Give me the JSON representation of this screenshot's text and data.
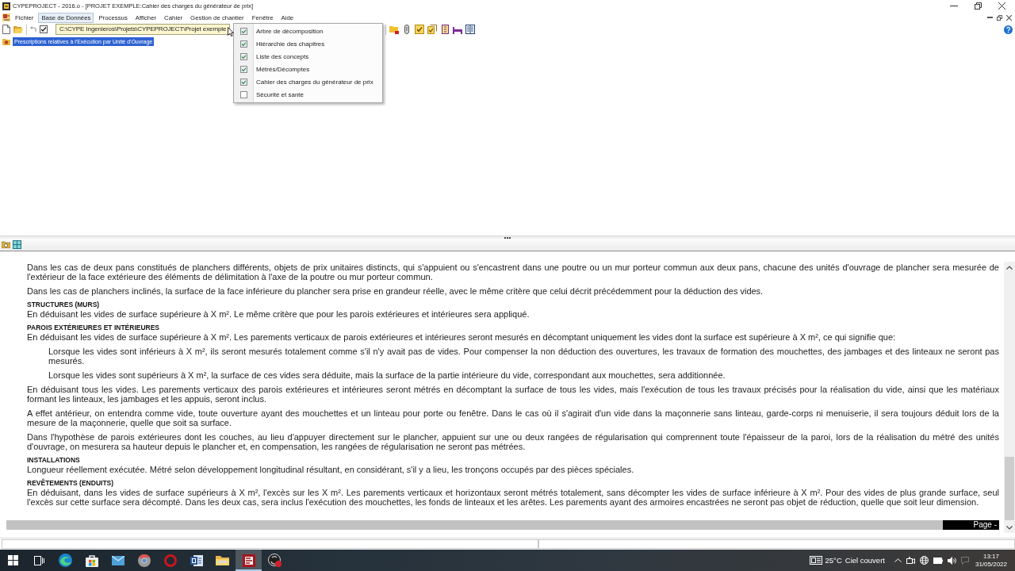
{
  "window": {
    "title": "CYPEPROJECT - 2016.o - [PROJET EXEMPLE:Cahier des charges du générateur de prix]"
  },
  "menu_bar": [
    {
      "label": "Fichier",
      "selected": false
    },
    {
      "label": "Base de Données",
      "selected": true
    },
    {
      "label": "Processus",
      "selected": false
    },
    {
      "label": "Afficher",
      "selected": false
    },
    {
      "label": "Cahier",
      "selected": false
    },
    {
      "label": "Gestion de chantier",
      "selected": false
    },
    {
      "label": "Fenêtre",
      "selected": false
    },
    {
      "label": "Aide",
      "selected": false
    }
  ],
  "toolbar": {
    "toggle": {
      "checked": true
    },
    "tooltip": "C:\\CYPE Ingenieros\\Projets\\CYPEPROJECT\\Projet exemple"
  },
  "dropdown_menu": [
    {
      "label": "Arbre de décomposition",
      "checked": true
    },
    {
      "label": "Hiérarchie des chapitres",
      "checked": true
    },
    {
      "label": "Liste des concepts",
      "checked": true
    },
    {
      "label": "Métrés/Décomptes",
      "checked": true
    },
    {
      "label": "Cahier des charges du générateur de prix",
      "checked": true
    },
    {
      "label": "Sécurité et santé",
      "checked": false
    }
  ],
  "tree": [
    {
      "label": "Prescriptions relatives à l'Exécution par Unité d'Ouvrage",
      "selected": true
    }
  ],
  "document": {
    "blocks": [
      {
        "kind": "paragraph",
        "text": "Dans les cas de deux pans constitués de planchers différents, objets de prix unitaires distincts, qui s'appuient ou s'encastrent dans une poutre ou un mur porteur commun aux deux pans, chacune des unités d'ouvrage de plancher sera mesurée de l'extérieur de la face extérieure des éléments de délimitation à l'axe de la poutre ou mur porteur commun."
      },
      {
        "kind": "paragraph",
        "text": "Dans les cas de planchers inclinés, la surface de la face inférieure du plancher sera prise en grandeur réelle, avec le même critère que celui décrit précédemment pour la déduction des vides."
      },
      {
        "kind": "heading",
        "text": "STRUCTURES (MURS)"
      },
      {
        "kind": "paragraph",
        "text": "En déduisant les vides de surface supérieure à X m². Le même critère que pour les parois extérieures et intérieures sera appliqué."
      },
      {
        "kind": "heading",
        "text": "PAROIS EXTÉRIEURES ET INTÉRIEURES"
      },
      {
        "kind": "paragraph",
        "text": "En déduisant les vides de surface supérieure à X m². Les parements verticaux de parois extérieures et intérieures seront mesurés en décomptant uniquement les vides dont la surface est supérieure à X m², ce qui signifie que:"
      },
      {
        "kind": "indented",
        "text": "Lorsque les vides sont inférieurs à X m², ils seront mesurés totalement comme s'il n'y avait pas de vides. Pour compenser la non déduction des ouvertures, les travaux de formation des mouchettes, des jambages et des linteaux ne seront pas mesurés."
      },
      {
        "kind": "indented",
        "text": "Lorsque les vides sont supérieurs à X m², la surface de ces vides sera déduite, mais la surface de la partie intérieure du vide, correspondant aux mouchettes, sera additionnée."
      },
      {
        "kind": "paragraph",
        "text": "En déduisant tous les vides. Les parements verticaux des parois extérieures et intérieures seront métrés en décomptant la surface de tous les vides, mais l'exécution de tous les travaux précisés pour la réalisation du vide, ainsi que les matériaux formant les linteaux, les jambages et les appuis, seront inclus."
      },
      {
        "kind": "paragraph",
        "text": "A effet antérieur, on entendra comme vide, toute ouverture ayant des mouchettes et un linteau pour porte ou fenêtre. Dans le cas où il s'agirait d'un vide dans la maçonnerie sans linteau, garde-corps ni menuiserie, il sera toujours déduit lors de la mesure de la maçonnerie, quelle que soit sa surface."
      },
      {
        "kind": "paragraph",
        "text": "Dans l'hypothèse de parois extérieures dont les couches, au lieu d'appuyer directement sur le plancher, appuient sur une ou deux rangées de régularisation qui comprennent toute l'épaisseur de la paroi, lors de la réalisation du métré des unités d'ouvrage, on mesurera sa hauteur depuis le plancher et, en compensation, les rangées de régularisation ne seront pas métrées."
      },
      {
        "kind": "heading",
        "text": "INSTALLATIONS"
      },
      {
        "kind": "paragraph",
        "text": "Longueur réellement exécutée. Métré selon développement longitudinal résultant, en considérant, s'il y a lieu, les tronçons occupés par des pièces spéciales."
      },
      {
        "kind": "heading",
        "text": "REVÊTEMENTS (ENDUITS)"
      },
      {
        "kind": "paragraph",
        "text": "En déduisant, dans les vides de surface supérieurs à X m², l'excès sur les X m². Les parements verticaux et horizontaux seront métrés totalement, sans décompter les vides de surface inférieure à X m². Pour des vides de plus grande surface, seul l'excès sur cette surface sera décompté. Dans les deux cas, sera inclus l'exécution des mouchettes, les fonds de linteaux et les arêtes. Les parements ayant des armoires encastrées ne seront pas objet de réduction, quelle que soit leur dimension."
      }
    ],
    "page_label": "Page -"
  },
  "taskbar": {
    "apps": [
      {
        "kind": "edge",
        "selected": false
      },
      {
        "kind": "store",
        "selected": false
      },
      {
        "kind": "mail",
        "selected": false
      },
      {
        "kind": "chrome",
        "selected": false
      },
      {
        "kind": "opera",
        "selected": false
      },
      {
        "kind": "word",
        "selected": false
      },
      {
        "kind": "files",
        "selected": false
      },
      {
        "kind": "cype",
        "selected": true
      },
      {
        "kind": "obs",
        "selected": false
      }
    ],
    "weather": {
      "temperature": "25°C",
      "condition": "Ciel couvert"
    },
    "clock": {
      "time": "13:17",
      "date": "31/05/2022"
    }
  }
}
